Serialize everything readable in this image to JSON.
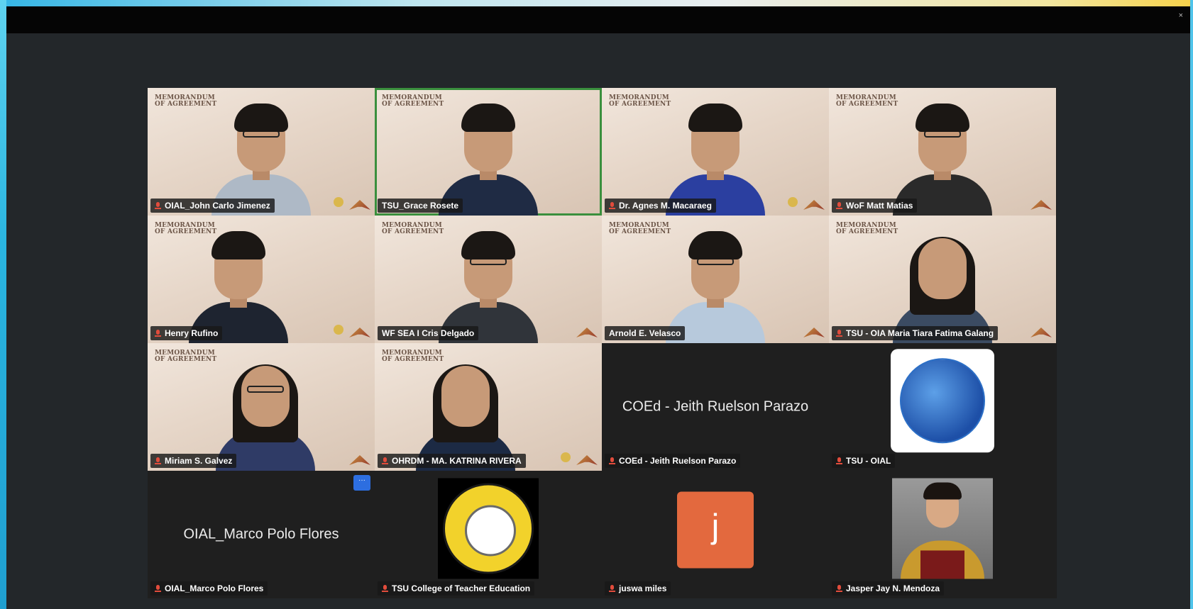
{
  "window": {
    "close_glyph": "×"
  },
  "backdrop": {
    "title": "MEMORANDUM\nOF AGREEMENT"
  },
  "more_options": {
    "label": "···"
  },
  "participants": [
    {
      "name": "OIAL_John Carlo Jimenez",
      "mic_muted": true
    },
    {
      "name": "TSU_Grace Rosete",
      "active_speaker": true
    },
    {
      "name": "Dr. Agnes M. Macaraeg",
      "mic_muted": true
    },
    {
      "name": "WoF Matt Matias",
      "mic_muted": true
    },
    {
      "name": "Henry Rufino",
      "mic_muted": true
    },
    {
      "name": "WF SEA I Cris Delgado"
    },
    {
      "name": "Arnold E. Velasco"
    },
    {
      "name": "TSU - OIA Maria Tiara Fatima Galang",
      "mic_muted": true
    },
    {
      "name": "Miriam S. Galvez",
      "mic_muted": true
    },
    {
      "name": "OHRDM - MA. KATRINA RIVERA",
      "mic_muted": true
    },
    {
      "name": "COEd - Jeith Ruelson Parazo",
      "display_name": "COEd - Jeith Ruelson Parazo",
      "mic_muted": true
    },
    {
      "name": "TSU - OIAL",
      "mic_muted": true,
      "avatar": "globe-logo"
    },
    {
      "name": "OIAL_Marco Polo Flores",
      "display_name": "OIAL_Marco Polo Flores",
      "mic_muted": true
    },
    {
      "name": "TSU College of Teacher Education",
      "mic_muted": true,
      "avatar": "college-of-education-seal"
    },
    {
      "name": "juswa miles",
      "mic_muted": true,
      "avatar_letter": "j",
      "avatar_color": "#e3693e"
    },
    {
      "name": "Jasper Jay N. Mendoza",
      "mic_muted": true,
      "avatar": "graduation-portrait"
    }
  ],
  "colors": {
    "active_speaker_border": "#3a8f3d",
    "muted_mic": "#e24c3c"
  }
}
